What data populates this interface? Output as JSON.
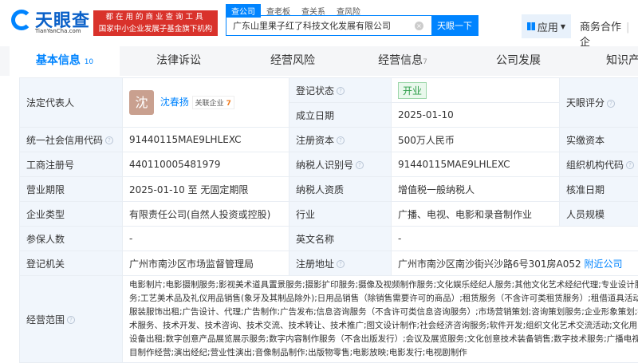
{
  "header": {
    "logo_name": "天眼查",
    "logo_sub": "TianYanCha.com",
    "banner_line1": "都在用的商业查询工具",
    "banner_line2": "国家中小企业发展子基金旗下机构",
    "search_tabs": [
      "查公司",
      "查老板",
      "查关系",
      "查风险"
    ],
    "search_value": "广东山里果子红了科技文化发展有限公司",
    "search_button": "天眼一下",
    "app_label": "应用",
    "biz_label": "商务合作",
    "extra": "企"
  },
  "nav": [
    {
      "label": "基本信息",
      "count": "10"
    },
    {
      "label": "法律诉讼"
    },
    {
      "label": "经营风险"
    },
    {
      "label": "经营信息",
      "count": "7"
    },
    {
      "label": "公司发展"
    },
    {
      "label": "知识产权"
    }
  ],
  "info": {
    "legal_rep_label": "法定代表人",
    "avatar_char": "沈",
    "legal_rep": "沈春扬",
    "related_label": "关联企业",
    "related_count": "7",
    "status_label": "登记状态",
    "status": "开业",
    "found_label": "成立日期",
    "found": "2025-01-10",
    "score_label": "天眼评分",
    "credit_label": "统一社会信用代码",
    "credit": "91440115MAE9LHLEXC",
    "capital_label": "注册资本",
    "capital": "500万人民币",
    "paid_label": "实缴资本",
    "reg_no_label": "工商注册号",
    "reg_no": "440110005481979",
    "tax_label": "纳税人识别号",
    "tax": "91440115MAE9LHLEXC",
    "org_label": "组织机构代码",
    "term_label": "营业期限",
    "term": "2025-01-10 至 无固定期限",
    "tax_q_label": "纳税人资质",
    "tax_q": "增值税一般纳税人",
    "approve_label": "核准日期",
    "type_label": "企业类型",
    "type": "有限责任公司(自然人投资或控股)",
    "industry_label": "行业",
    "industry": "广播、电视、电影和录音制作业",
    "staff_label": "人员规模",
    "insured_label": "参保人数",
    "insured": "-",
    "en_label": "英文名称",
    "en": "-",
    "authority_label": "登记机关",
    "authority": "广州市南沙区市场监督管理局",
    "address_label": "注册地址",
    "address": "广州市南沙区南沙街兴沙路6号301房A052",
    "nearby": "附近公司",
    "scope_label": "经营范围",
    "scope": "电影制片;电影摄制服务;影视美术道具置景服务;摄影扩印服务;摄像及视频制作服务;文化娱乐经纪人服务;其他文化艺术经纪代理;专业设计服务;工艺美术品及礼仪用品销售(象牙及其制品除外);日用品销售（除销售需要许可的商品）;租赁服务（不含许可类租赁服务）;租借道具活动;服装服饰出租;广告设计、代理;广告制作;广告发布;信息咨询服务（不含许可类信息咨询服务）;市场营销策划;咨询策划服务;企业形象策划;技术服务、技术开发、技术咨询、技术交流、技术转让、技术推广;图文设计制作;社会经济咨询服务;软件开发;组织文化艺术交流活动;文化用品设备出租;数字创意产品展览展示服务;数字内容制作服务（不含出版发行）;会议及展览服务;文化创意技术装备销售;数字技术服务;广播电视节目制作经营;演出经纪;营业性演出;音像制品制作;出版物零售;电影放映;电影发行;电视剧制作"
  }
}
